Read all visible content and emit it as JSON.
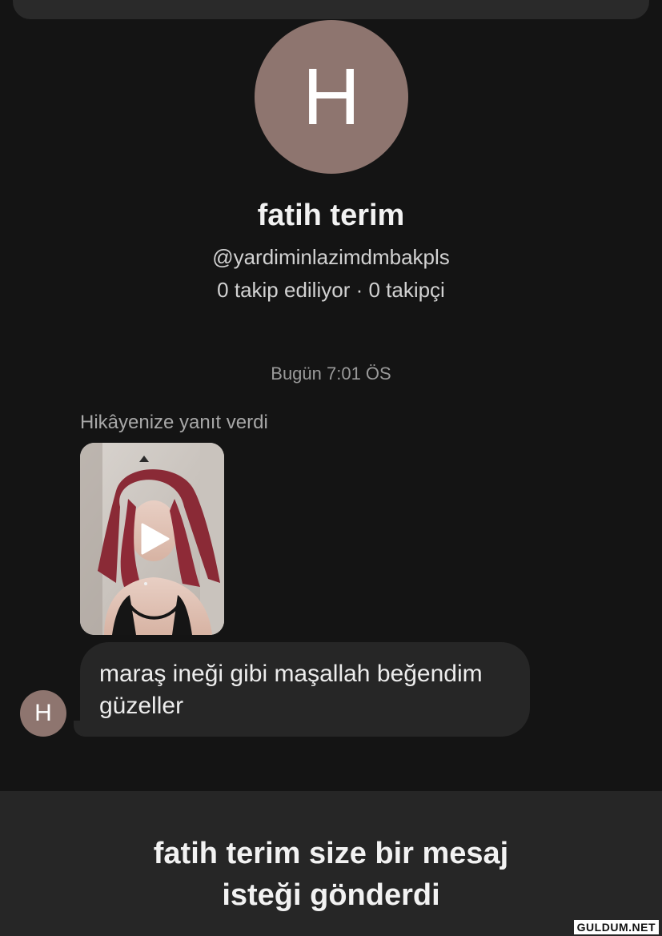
{
  "profile": {
    "avatar_letter": "H",
    "name": "fatih terim",
    "handle": "@yardiminlazimdmbakpls",
    "stats": "0 takip ediliyor · 0 takipçi"
  },
  "conversation": {
    "timestamp": "Bugün 7:01 ÖS",
    "story_reply_label": "Hikâyenize yanıt verdi",
    "sender_avatar_letter": "H",
    "message_line1": "maraş ineği gibi maşallah beğendim",
    "message_line2": "güzeller"
  },
  "request": {
    "line1": "fatih terim size bir mesaj",
    "line2": "isteği gönderdi"
  },
  "watermark": "GULDUM.NET",
  "colors": {
    "background": "#141414",
    "avatar": "#8e756f",
    "bubble": "#262626",
    "panel": "#262626"
  }
}
